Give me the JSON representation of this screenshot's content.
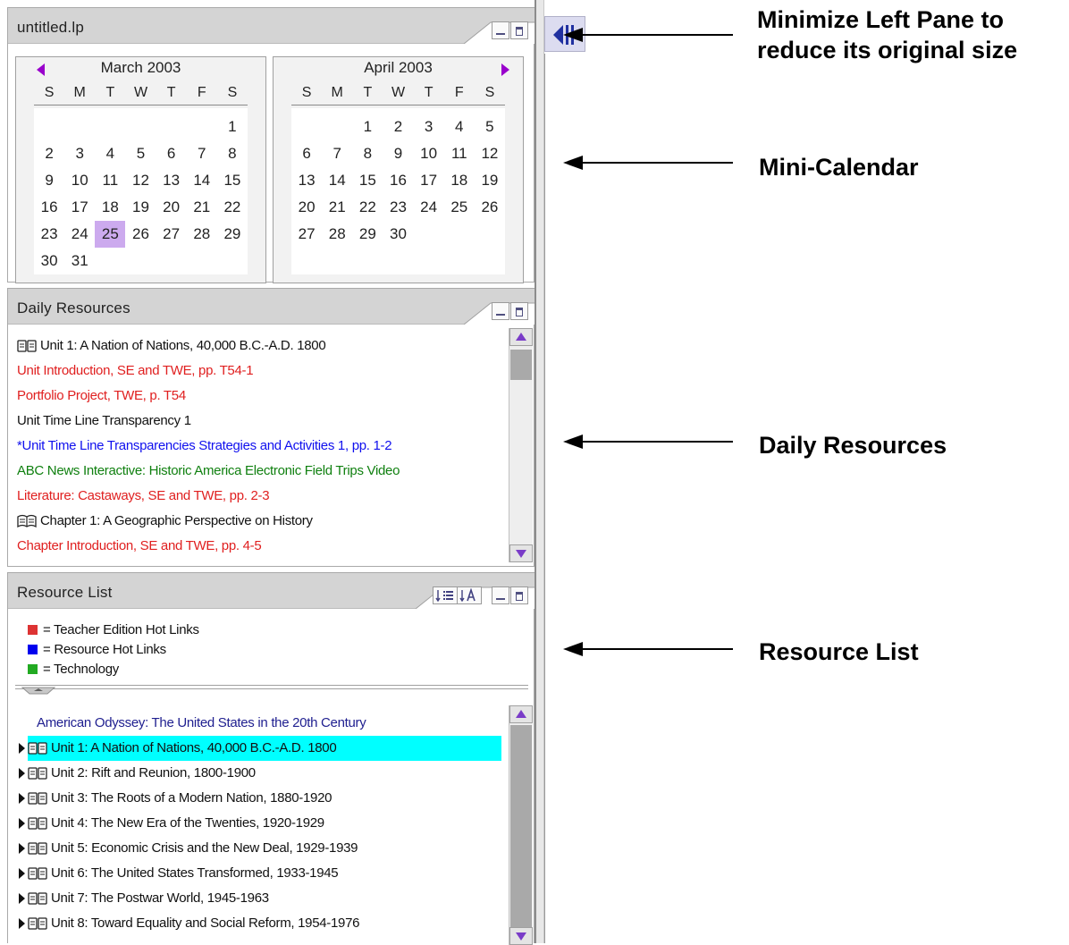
{
  "calendar_panel": {
    "title": "untitled.lp"
  },
  "calendar": {
    "months": [
      {
        "title": "March 2003",
        "weekdays": [
          "S",
          "M",
          "T",
          "W",
          "T",
          "F",
          "S"
        ],
        "days": [
          "",
          "",
          "",
          "",
          "",
          "",
          "1",
          "2",
          "3",
          "4",
          "5",
          "6",
          "7",
          "8",
          "9",
          "10",
          "11",
          "12",
          "13",
          "14",
          "15",
          "16",
          "17",
          "18",
          "19",
          "20",
          "21",
          "22",
          "23",
          "24",
          "25",
          "26",
          "27",
          "28",
          "29",
          "30",
          "31"
        ],
        "selected_day": "25"
      },
      {
        "title": "April 2003",
        "weekdays": [
          "S",
          "M",
          "T",
          "W",
          "T",
          "F",
          "S"
        ],
        "days": [
          "",
          "",
          "1",
          "2",
          "3",
          "4",
          "5",
          "6",
          "7",
          "8",
          "9",
          "10",
          "11",
          "12",
          "13",
          "14",
          "15",
          "16",
          "17",
          "18",
          "19",
          "20",
          "21",
          "22",
          "23",
          "24",
          "25",
          "26",
          "27",
          "28",
          "29",
          "30"
        ],
        "selected_day": ""
      }
    ]
  },
  "daily_resources": {
    "title": "Daily Resources",
    "items": [
      {
        "text": "Unit 1: A Nation of Nations, 40,000 B.C.-A.D. 1800",
        "color": "black",
        "icon": "book-icon"
      },
      {
        "text": "Unit Introduction, SE and TWE, pp. T54-1",
        "color": "red",
        "icon": ""
      },
      {
        "text": "Portfolio Project, TWE, p. T54",
        "color": "red",
        "icon": ""
      },
      {
        "text": "Unit Time Line Transparency 1",
        "color": "black",
        "icon": ""
      },
      {
        "text": "*Unit Time Line Transparencies Strategies and Activities 1, pp. 1-2",
        "color": "blue",
        "icon": ""
      },
      {
        "text": "ABC News Interactive: Historic America Electronic Field Trips Video",
        "color": "green",
        "icon": ""
      },
      {
        "text": "Literature: Castaways, SE and TWE, pp. 2-3",
        "color": "red",
        "icon": ""
      },
      {
        "text": "Chapter 1: A Geographic Perspective on History",
        "color": "black",
        "icon": "open-book-icon"
      },
      {
        "text": "Chapter Introduction, SE and TWE, pp. 4-5",
        "color": "red",
        "icon": ""
      }
    ]
  },
  "resource_list": {
    "title": "Resource List",
    "sort_buttons": [
      "sort-numeric-icon",
      "sort-alpha-icon"
    ],
    "legend": [
      {
        "swatch": "#dd3333",
        "label": "= Teacher Edition Hot Links"
      },
      {
        "swatch": "#0000ee",
        "label": "= Resource Hot Links"
      },
      {
        "swatch": "#22aa22",
        "label": "= Technology"
      }
    ],
    "tree_title": "American Odyssey: The United States in the 20th Century",
    "units": [
      {
        "label": "Unit 1: A Nation of Nations, 40,000 B.C.-A.D. 1800",
        "selected": true
      },
      {
        "label": "Unit 2: Rift and Reunion, 1800-1900",
        "selected": false
      },
      {
        "label": "Unit 3: The Roots of a Modern Nation, 1880-1920",
        "selected": false
      },
      {
        "label": "Unit 4: The New Era of the Twenties, 1920-1929",
        "selected": false
      },
      {
        "label": "Unit 5: Economic Crisis and the New Deal, 1929-1939",
        "selected": false
      },
      {
        "label": "Unit 6: The United States Transformed, 1933-1945",
        "selected": false
      },
      {
        "label": "Unit 7: The Postwar World, 1945-1963",
        "selected": false
      },
      {
        "label": "Unit 8: Toward Equality and Social Reform, 1954-1976",
        "selected": false
      }
    ]
  },
  "annotations": {
    "minimize_line1": "Minimize Left Pane to",
    "minimize_line2": "reduce its original size",
    "mini_calendar": "Mini-Calendar",
    "daily_resources": "Daily Resources",
    "resource_list": "Resource List"
  },
  "colors": {
    "accent_purple": "#9900cc",
    "selected_day": "#ccaaee",
    "selected_row": "#00ffff",
    "red": "#e02020",
    "blue": "#1010ee",
    "green": "#108010",
    "navy": "#202090"
  }
}
